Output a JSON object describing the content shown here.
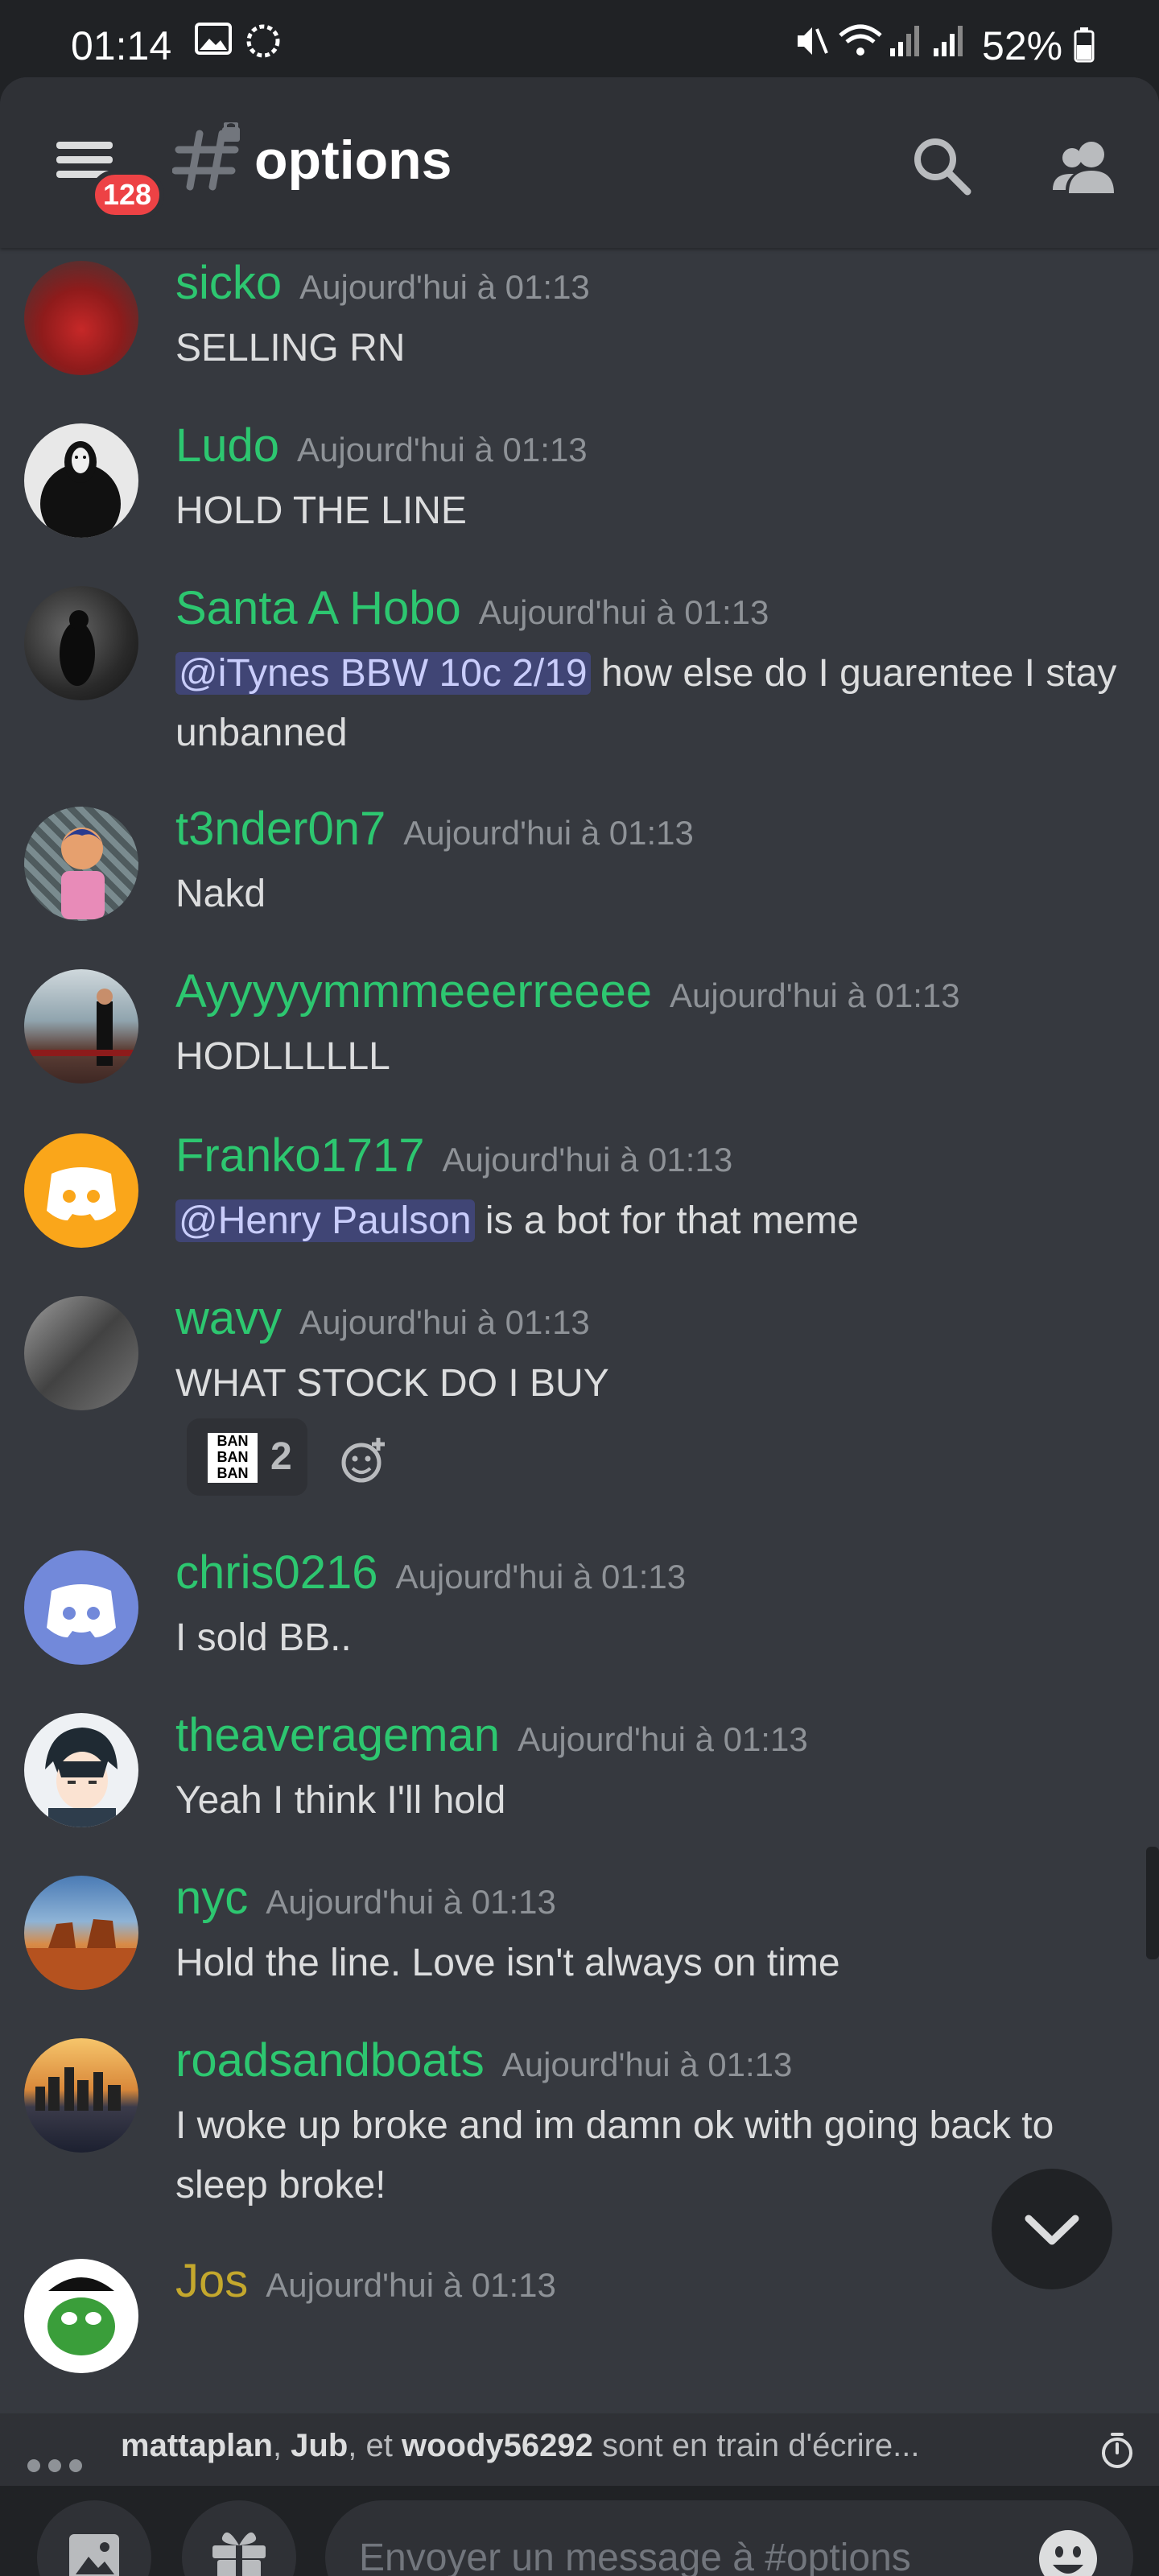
{
  "statusbar": {
    "time": "01:14",
    "battery": "52%"
  },
  "header": {
    "channel": "options",
    "unread_badge": "128"
  },
  "messages": [
    {
      "user": "sicko",
      "time": "Aujourd'hui à 01:13",
      "text": "SELLING RN"
    },
    {
      "user": "Ludo",
      "time": "Aujourd'hui à 01:13",
      "text": "HOLD THE LINE"
    },
    {
      "user": "Santa A Hobo",
      "time": "Aujourd'hui à 01:13",
      "mention": "@iTynes BBW 10c 2/19",
      "text": " how else do I guarentee I stay unbanned"
    },
    {
      "user": "t3nder0n7",
      "time": "Aujourd'hui à 01:13",
      "text": "Nakd"
    },
    {
      "user": "Ayyyyymmmeeerreeee",
      "time": "Aujourd'hui à 01:13",
      "text": "HODLLLLLL"
    },
    {
      "user": "Franko1717",
      "time": "Aujourd'hui à 01:13",
      "mention": "@Henry Paulson",
      "text": " is a bot for that meme"
    },
    {
      "user": "wavy",
      "time": "Aujourd'hui à 01:13",
      "text": "WHAT STOCK DO I BUY",
      "reaction_emoji": [
        "BAN",
        "BAN",
        "BAN"
      ],
      "reaction_count": "2"
    },
    {
      "user": "chris0216",
      "time": "Aujourd'hui à 01:13",
      "text": "I sold BB.."
    },
    {
      "user": "theaverageman",
      "time": "Aujourd'hui à 01:13",
      "text": "Yeah I think I'll hold"
    },
    {
      "user": "nyc",
      "time": "Aujourd'hui à 01:13",
      "text": "Hold the line. Love isn't always on time"
    },
    {
      "user": "roadsandboats",
      "time": "Aujourd'hui à 01:13",
      "text": "I woke up broke and im damn ok with going back to sleep broke!"
    },
    {
      "user": "Jos",
      "time": "Aujourd'hui à 01:13",
      "text": ""
    }
  ],
  "typing": {
    "user1": "mattaplan",
    "sep1": ", ",
    "user2": "Jub",
    "sep2": ", et ",
    "user3": "woody56292",
    "suffix": " sont en train d'écrire..."
  },
  "composer": {
    "placeholder": "Envoyer un message à #options"
  },
  "colors": {
    "background": "#36393f",
    "header": "#2f3136",
    "username": "#2dc770",
    "username_alt": "#c4a82d",
    "badge": "#ed4245",
    "mention": "#c9cdfb"
  },
  "icons": {
    "menu": "hamburger-icon",
    "channel": "text-channel-locked-icon",
    "search": "search-icon",
    "members": "members-icon",
    "image": "image-icon",
    "gift": "gift-icon",
    "emoji": "emoji-icon",
    "scroll_down": "chevron-down-icon",
    "add_reaction": "add-reaction-icon",
    "slowmode": "timer-icon"
  }
}
